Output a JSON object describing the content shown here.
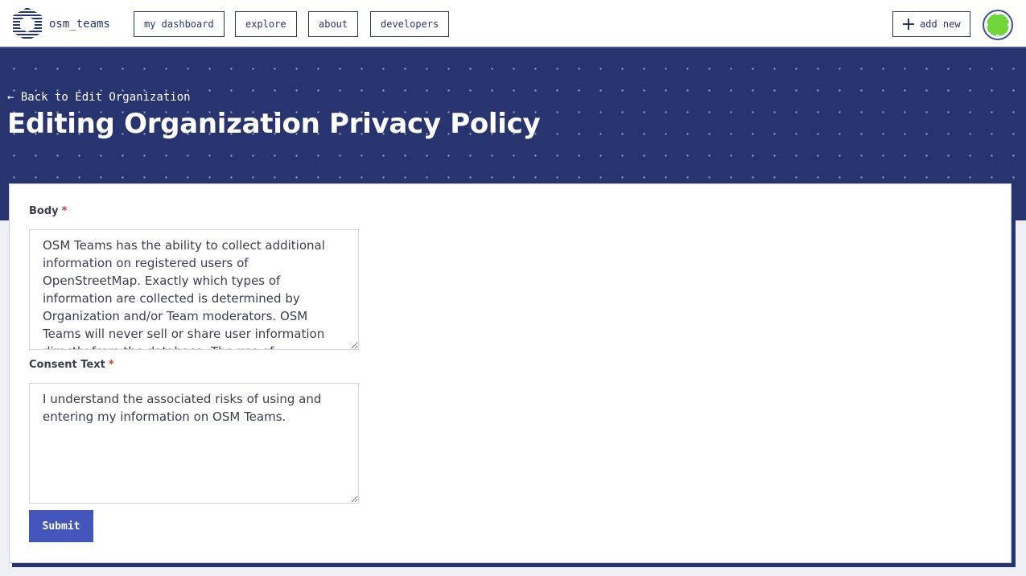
{
  "header": {
    "brand_name": "osm_teams",
    "logo_icon": "osm-teams-logo-icon",
    "nav": [
      {
        "label": "my dashboard"
      },
      {
        "label": "explore"
      },
      {
        "label": "about"
      },
      {
        "label": "developers"
      }
    ],
    "add_new_label": "add new",
    "add_new_icon": "plus-icon",
    "avatar_icon": "user-avatar-icon",
    "colors": {
      "primary": "#28346f",
      "accent": "#4456bb",
      "avatar": "#6fd637"
    }
  },
  "hero": {
    "back_link": "← Back to Edit Organization",
    "title": "Editing Organization Privacy Policy"
  },
  "form": {
    "body": {
      "label": "Body",
      "required_marker": "*",
      "value": "OSM Teams has the ability to collect additional information on registered users of OpenStreetMap. Exactly which types of information are collected is determined by Organization and/or Team moderators. OSM Teams will never sell or share user information directly from the database. The use of"
    },
    "consent": {
      "label": "Consent Text",
      "required_marker": "*",
      "value": "I understand the associated risks of using and entering my information on OSM Teams."
    },
    "submit_label": "Submit"
  }
}
